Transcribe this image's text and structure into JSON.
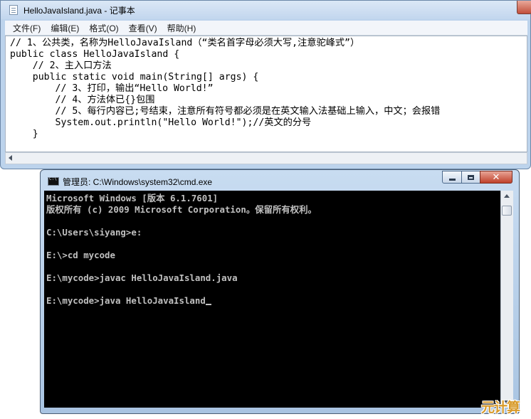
{
  "notepad": {
    "title": "HelloJavaIsland.java - 记事本",
    "menu": [
      "文件(F)",
      "编辑(E)",
      "格式(O)",
      "查看(V)",
      "帮助(H)"
    ],
    "code_lines": [
      "// 1、公共类，名称为HelloJavaIsland（“类名首字母必须大写,注意驼峰式”）",
      "public class HelloJavaIsland {",
      "    // 2、主入口方法",
      "    public static void main(String[] args) {",
      "        // 3、打印，输出“Hello World!”",
      "        // 4、方法体已{}包围",
      "        // 5、每行内容已;号结束，注意所有符号都必须是在英文输入法基础上输入，中文；会报错",
      "        System.out.println(\"Hello World!\");//英文的分号",
      "    }"
    ]
  },
  "cmd": {
    "title": "管理员: C:\\Windows\\system32\\cmd.exe",
    "console_lines": [
      "Microsoft Windows [版本 6.1.7601]",
      "版权所有 (c) 2009 Microsoft Corporation。保留所有权利。",
      "",
      "C:\\Users\\siyang>e:",
      "",
      "E:\\>cd mycode",
      "",
      "E:\\mycode>javac HelloJavaIsland.java",
      "",
      "E:\\mycode>java HelloJavaIsland"
    ]
  },
  "watermark": "元计算"
}
